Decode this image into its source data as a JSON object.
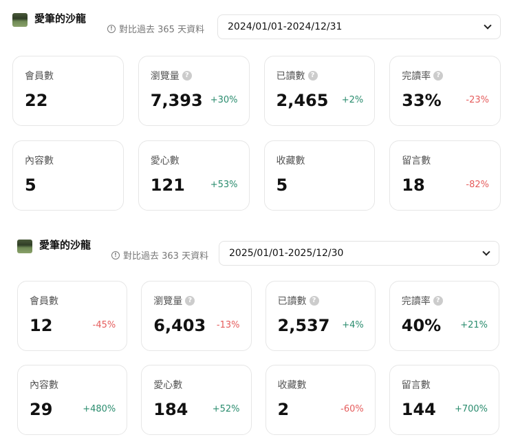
{
  "sections": [
    {
      "title": "愛筆的沙龍",
      "compare": "對比過去 365 天資料",
      "date_range": "2024/01/01-2024/12/31",
      "cards": [
        {
          "label": "會員數",
          "value": "22",
          "change": "",
          "help": false
        },
        {
          "label": "瀏覽量",
          "value": "7,393",
          "change": "+30%",
          "help": true
        },
        {
          "label": "已讀數",
          "value": "2,465",
          "change": "+2%",
          "help": true
        },
        {
          "label": "完讀率",
          "value": "33%",
          "change": "-23%",
          "help": true
        },
        {
          "label": "內容數",
          "value": "5",
          "change": "",
          "help": false
        },
        {
          "label": "愛心數",
          "value": "121",
          "change": "+53%",
          "help": false
        },
        {
          "label": "收藏數",
          "value": "5",
          "change": "",
          "help": false
        },
        {
          "label": "留言數",
          "value": "18",
          "change": "-82%",
          "help": false
        }
      ]
    },
    {
      "title": "愛筆的沙龍",
      "compare": "對比過去 363 天資料",
      "date_range": "2025/01/01-2025/12/30",
      "cards": [
        {
          "label": "會員數",
          "value": "12",
          "change": "-45%",
          "help": false
        },
        {
          "label": "瀏覽量",
          "value": "6,403",
          "change": "-13%",
          "help": true
        },
        {
          "label": "已讀數",
          "value": "2,537",
          "change": "+4%",
          "help": true
        },
        {
          "label": "完讀率",
          "value": "40%",
          "change": "+21%",
          "help": true
        },
        {
          "label": "內容數",
          "value": "29",
          "change": "+480%",
          "help": false
        },
        {
          "label": "愛心數",
          "value": "184",
          "change": "+52%",
          "help": false
        },
        {
          "label": "收藏數",
          "value": "2",
          "change": "-60%",
          "help": false
        },
        {
          "label": "留言數",
          "value": "144",
          "change": "+700%",
          "help": false
        }
      ]
    }
  ],
  "colors": {
    "positive": "#2a8c6e",
    "negative": "#e55c5c"
  }
}
